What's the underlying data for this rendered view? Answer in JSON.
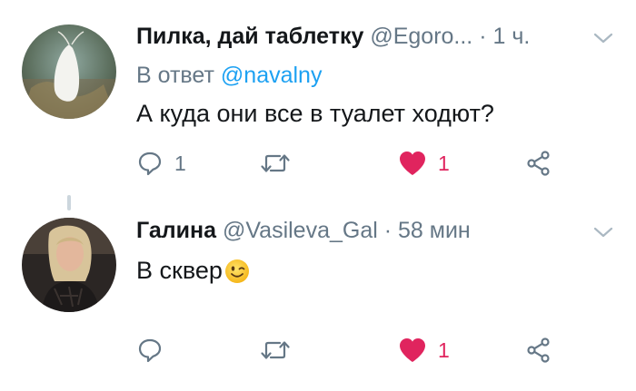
{
  "tweets": [
    {
      "author_name": "Пилка, дай таблетку",
      "author_handle": "@Egoro...",
      "separator": "·",
      "time": "1 ч.",
      "reply_prefix": "В ответ",
      "reply_to": "@navalny",
      "text": "А куда они все в туалет ходют?",
      "emoji": "",
      "reply_count": "1",
      "retweet_count": "",
      "like_count": "1",
      "liked": true
    },
    {
      "author_name": "Галина",
      "author_handle": "@Vasileva_Gal",
      "separator": "·",
      "time": "58 мин",
      "text": "В сквер",
      "emoji": "winking-face",
      "reply_count": "",
      "retweet_count": "",
      "like_count": "1",
      "liked": true
    }
  ],
  "colors": {
    "name": "#14171a",
    "muted": "#657786",
    "link": "#1da1f2",
    "like": "#e0245e",
    "thread_line": "#ccd6dd"
  },
  "icons": [
    "caret-down-icon",
    "reply-icon",
    "retweet-icon",
    "heart-icon",
    "share-icon",
    "winking-face-emoji"
  ]
}
